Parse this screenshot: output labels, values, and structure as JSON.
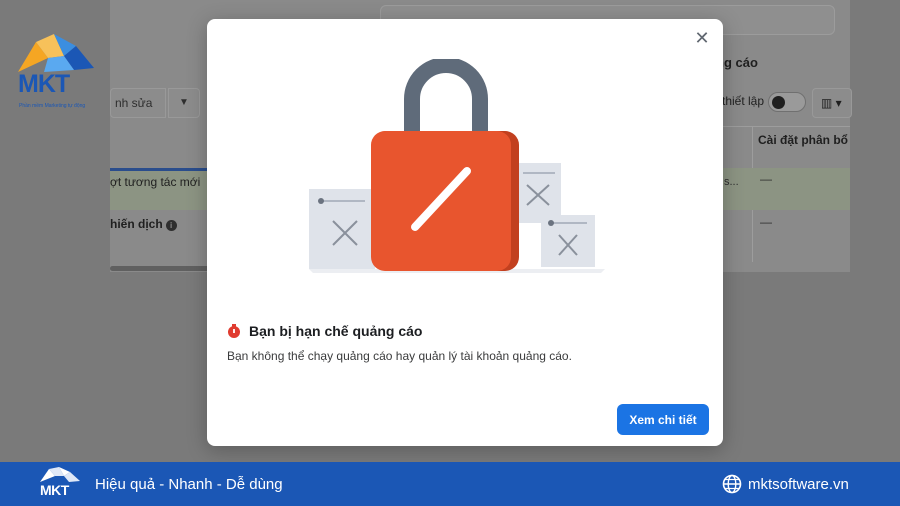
{
  "background": {
    "header_title": "ng cáo",
    "edit_label": "nh sửa",
    "caret_icon": "caret-down-icon",
    "setup_label": "thiết lập",
    "columns_icon": "columns-icon",
    "column_header": "Cài đặt phân bổ",
    "rows": [
      {
        "label": "ợt tương tác mới",
        "truncated": "s...",
        "value": "—"
      },
      {
        "label": "hiến dịch",
        "info_icon": "info-icon",
        "value": "—"
      }
    ]
  },
  "logo": {
    "text": "MKT",
    "tagline": "Phần mềm Marketing tự động",
    "brand_color": "#1b57b5"
  },
  "modal": {
    "close_icon": "close-icon",
    "close_glyph": "✕",
    "illustration": "padlock-with-document-icons",
    "alert_icon": "restriction-alert-icon",
    "title": "Bạn bị hạn chế quảng cáo",
    "description": "Bạn không thể chạy quảng cáo hay quản lý tài khoản quảng cáo.",
    "button_label": "Xem chi tiết",
    "button_color": "#1b74e4",
    "lock_color": "#e8552e"
  },
  "footer": {
    "logo_text": "MKT",
    "slogan": "Hiệu quả - Nhanh - Dễ dùng",
    "globe_icon": "globe-icon",
    "website": "mktsoftware.vn",
    "bar_color": "#1b57b5"
  }
}
